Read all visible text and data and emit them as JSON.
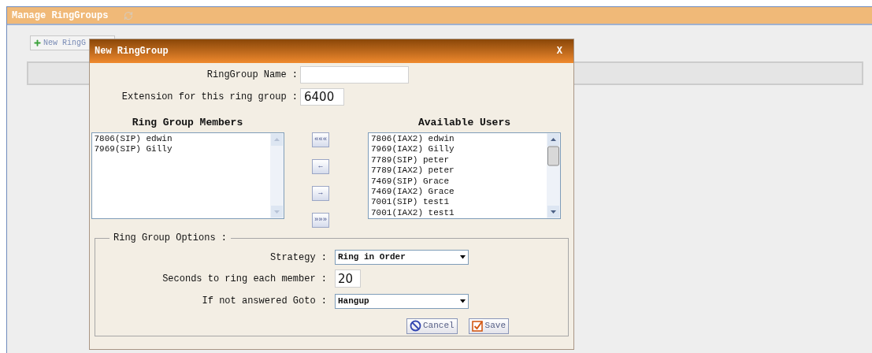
{
  "page": {
    "title": "Manage RingGroups",
    "new_button": "New RingG"
  },
  "dialog": {
    "title": "New RingGroup",
    "close": "X",
    "fields": [
      {
        "label": "RingGroup Name :"
      },
      {
        "label": "Extension for this ring group :",
        "value": "6400"
      }
    ],
    "members": {
      "title": "Ring Group Members",
      "items": [
        "7806(SIP) edwin",
        "7969(SIP) Gilly"
      ]
    },
    "available": {
      "title": "Available Users",
      "items": [
        "7806(IAX2) edwin",
        "7969(IAX2) Gilly",
        "7789(SIP) peter",
        "7789(IAX2) peter",
        "7469(SIP) Grace",
        "7469(IAX2) Grace",
        "7001(SIP) test1",
        "7001(IAX2) test1"
      ]
    },
    "move_buttons": [
      "«««",
      "←",
      "→",
      "»»»"
    ],
    "options": {
      "legend": "Ring Group Options :",
      "rows": [
        {
          "kind": "select",
          "label": "Strategy :",
          "value": "Ring in Order"
        },
        {
          "kind": "text",
          "label": "Seconds to ring each member :",
          "value": "20"
        },
        {
          "kind": "select",
          "label": "If not answered Goto :",
          "value": "Hangup"
        }
      ]
    },
    "buttons": [
      {
        "kind": "cancel",
        "label": "Cancel"
      },
      {
        "kind": "save",
        "label": "Save"
      }
    ]
  }
}
